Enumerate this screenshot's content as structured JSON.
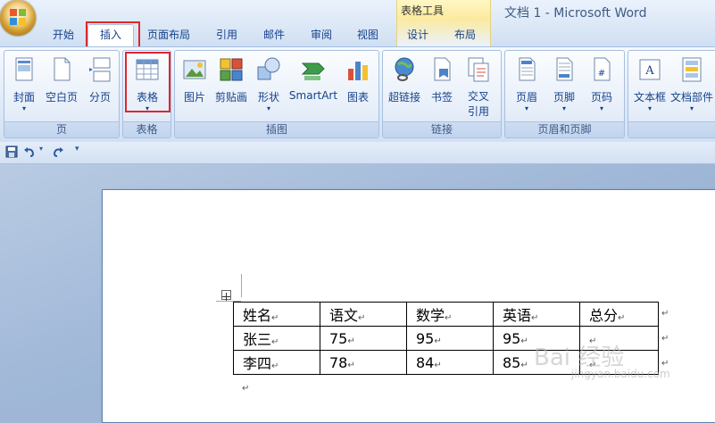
{
  "window": {
    "title": "文档 1 - Microsoft Word",
    "contextual_group": "表格工具"
  },
  "tabs": [
    "开始",
    "插入",
    "页面布局",
    "引用",
    "邮件",
    "审阅",
    "视图",
    "设计",
    "布局"
  ],
  "active_tab": "插入",
  "ribbon": {
    "groups": [
      {
        "label": "页",
        "buttons": [
          {
            "label": "封面",
            "icon": "cover-page-icon",
            "dropdown": true
          },
          {
            "label": "空白页",
            "icon": "blank-page-icon"
          },
          {
            "label": "分页",
            "icon": "page-break-icon"
          }
        ]
      },
      {
        "label": "表格",
        "buttons": [
          {
            "label": "表格",
            "icon": "table-icon",
            "dropdown": true
          }
        ]
      },
      {
        "label": "插图",
        "buttons": [
          {
            "label": "图片",
            "icon": "picture-icon"
          },
          {
            "label": "剪贴画",
            "icon": "clip-art-icon"
          },
          {
            "label": "形状",
            "icon": "shapes-icon",
            "dropdown": true
          },
          {
            "label": "SmartArt",
            "icon": "smartart-icon"
          },
          {
            "label": "图表",
            "icon": "chart-icon"
          }
        ]
      },
      {
        "label": "链接",
        "buttons": [
          {
            "label": "超链接",
            "icon": "hyperlink-icon"
          },
          {
            "label": "书签",
            "icon": "bookmark-icon"
          },
          {
            "label": "交叉\n引用",
            "icon": "cross-reference-icon"
          }
        ]
      },
      {
        "label": "页眉和页脚",
        "buttons": [
          {
            "label": "页眉",
            "icon": "header-icon",
            "dropdown": true
          },
          {
            "label": "页脚",
            "icon": "footer-icon",
            "dropdown": true
          },
          {
            "label": "页码",
            "icon": "page-number-icon",
            "dropdown": true
          }
        ]
      },
      {
        "label": "",
        "buttons": [
          {
            "label": "文本框",
            "icon": "text-box-icon",
            "dropdown": true
          },
          {
            "label": "文档部件",
            "icon": "quick-parts-icon",
            "dropdown": true
          }
        ]
      }
    ]
  },
  "quick_access": [
    "save-icon",
    "undo-icon",
    "redo-icon",
    "customize-icon"
  ],
  "table": {
    "header": [
      "姓名",
      "语文",
      "数学",
      "英语",
      "总分"
    ],
    "rows": [
      [
        "张三",
        "75",
        "95",
        "95",
        ""
      ],
      [
        "李四",
        "78",
        "84",
        "85",
        ""
      ]
    ]
  },
  "watermark": {
    "text": "Bai 经验",
    "sub": "jingyan.baidu.com"
  },
  "colors": {
    "highlight": "#e0262b",
    "ribbon_text": "#15428b"
  }
}
